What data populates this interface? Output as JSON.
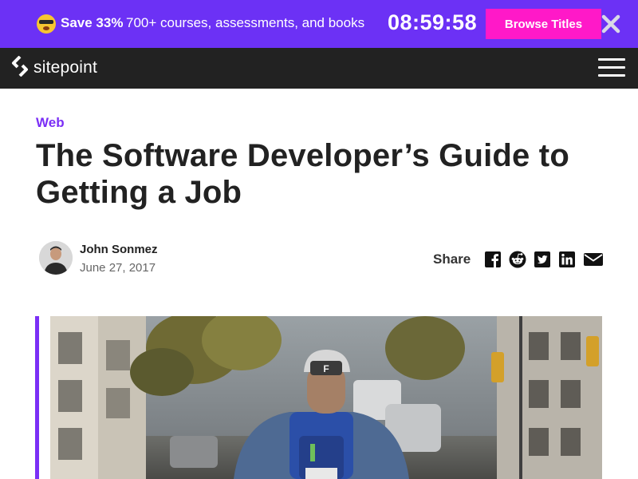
{
  "promo": {
    "emoji_icon": "shocked-face-emoji",
    "save_label": "Save 33%",
    "text": "700+ courses, assessments, and books",
    "timer": "08:59:58",
    "button_label": "Browse Titles",
    "close_icon": "close-icon",
    "colors": {
      "background": "#6c31f5",
      "button": "#ff19c8"
    }
  },
  "nav": {
    "logo_text": "sitepoint",
    "menu_icon": "hamburger-menu-icon"
  },
  "article": {
    "category": "Web",
    "title": "The Software Developer’s Guide to Getting a Job",
    "author": "John Sonmez",
    "date": "June 27, 2017",
    "share_label": "Share",
    "share_icons": [
      "facebook-icon",
      "reddit-icon",
      "twitter-icon",
      "linkedin-icon",
      "email-icon"
    ],
    "accent_color": "#7b2ff6"
  }
}
